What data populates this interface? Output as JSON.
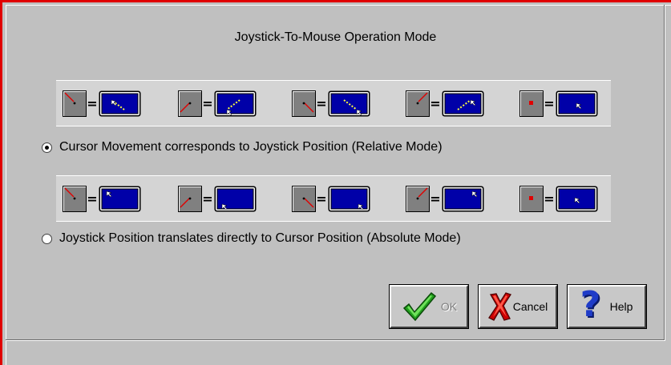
{
  "dialog": {
    "title": "Joystick-To-Mouse Operation Mode"
  },
  "relative_mode": {
    "label": "Cursor Movement corresponds to Joystick Position (Relative Mode)",
    "selected": true,
    "examples": [
      {
        "joystick": "up-left",
        "cursor": "move-up-left"
      },
      {
        "joystick": "down-left",
        "cursor": "move-down-left"
      },
      {
        "joystick": "down-right",
        "cursor": "move-down-right"
      },
      {
        "joystick": "up-right",
        "cursor": "move-up-right"
      },
      {
        "joystick": "center",
        "cursor": "stay-center"
      }
    ]
  },
  "absolute_mode": {
    "label": "Joystick Position translates directly to Cursor Position (Absolute Mode)",
    "selected": false,
    "examples": [
      {
        "joystick": "up-left",
        "cursor": "top-left"
      },
      {
        "joystick": "down-left",
        "cursor": "bottom-left"
      },
      {
        "joystick": "down-right",
        "cursor": "bottom-right"
      },
      {
        "joystick": "up-right",
        "cursor": "top-right"
      },
      {
        "joystick": "center",
        "cursor": "center"
      }
    ]
  },
  "equals_sign": "=",
  "buttons": {
    "ok_label": "OK",
    "cancel_label": "Cancel",
    "help_label": "Help",
    "help_symbol": "?"
  },
  "colors": {
    "window_border": "#e00000",
    "dialog_face": "#c0c0c0",
    "screen_blue": "#0000a8",
    "joystick_gray": "#808080",
    "ok_check": "#22a01e",
    "cancel_x": "#cc0000",
    "help_q": "#1f3cc8"
  }
}
